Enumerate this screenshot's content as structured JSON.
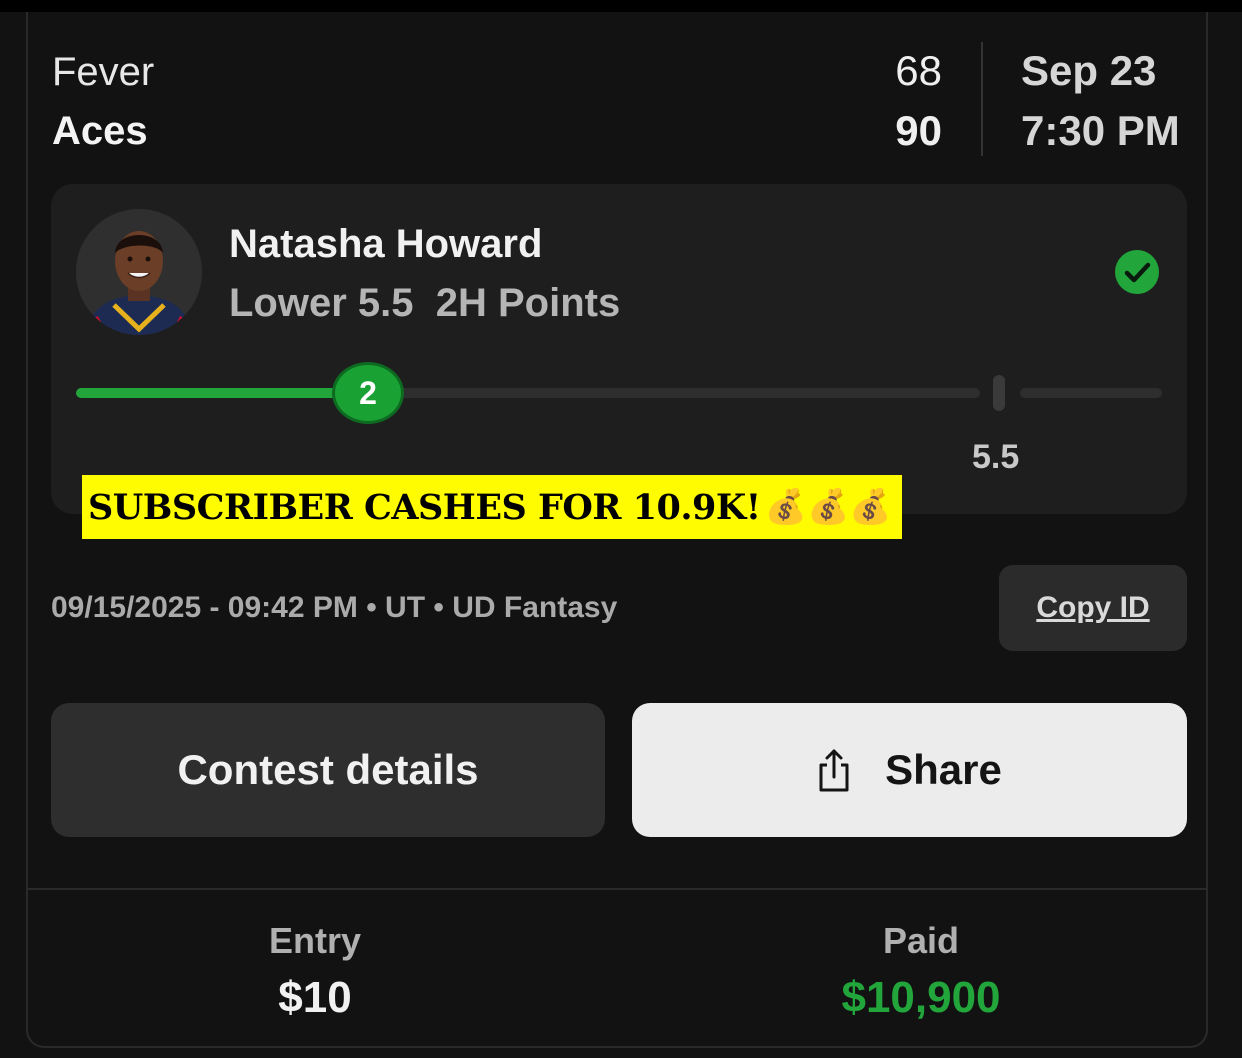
{
  "game": {
    "team1": "Fever",
    "team2": "Aces",
    "score1": "68",
    "score2": "90",
    "date": "Sep 23",
    "time": "7:30 PM"
  },
  "pick": {
    "player_name": "Natasha Howard",
    "line_text": "Lower 5.5  2H Points",
    "current_value": "2",
    "current_value_fraction": 0.343,
    "line_value": "5.5",
    "status": "won",
    "status_color": "#22a53a"
  },
  "banner": {
    "text": "SUBSCRIBER CASHES FOR 10.9K!",
    "emoji": "💰💰💰",
    "background": "#fffb00"
  },
  "meta": {
    "line": "09/15/2025 - 09:42 PM • UT • UD Fantasy",
    "copy_label": "Copy ID"
  },
  "actions": {
    "contest_label": "Contest details",
    "share_label": "Share"
  },
  "footer": {
    "entry_label": "Entry",
    "entry_value": "$10",
    "paid_label": "Paid",
    "paid_value": "$10,900",
    "paid_color": "#22a53a"
  },
  "icons": [
    "check-circle-icon",
    "share-icon",
    "player-avatar"
  ]
}
